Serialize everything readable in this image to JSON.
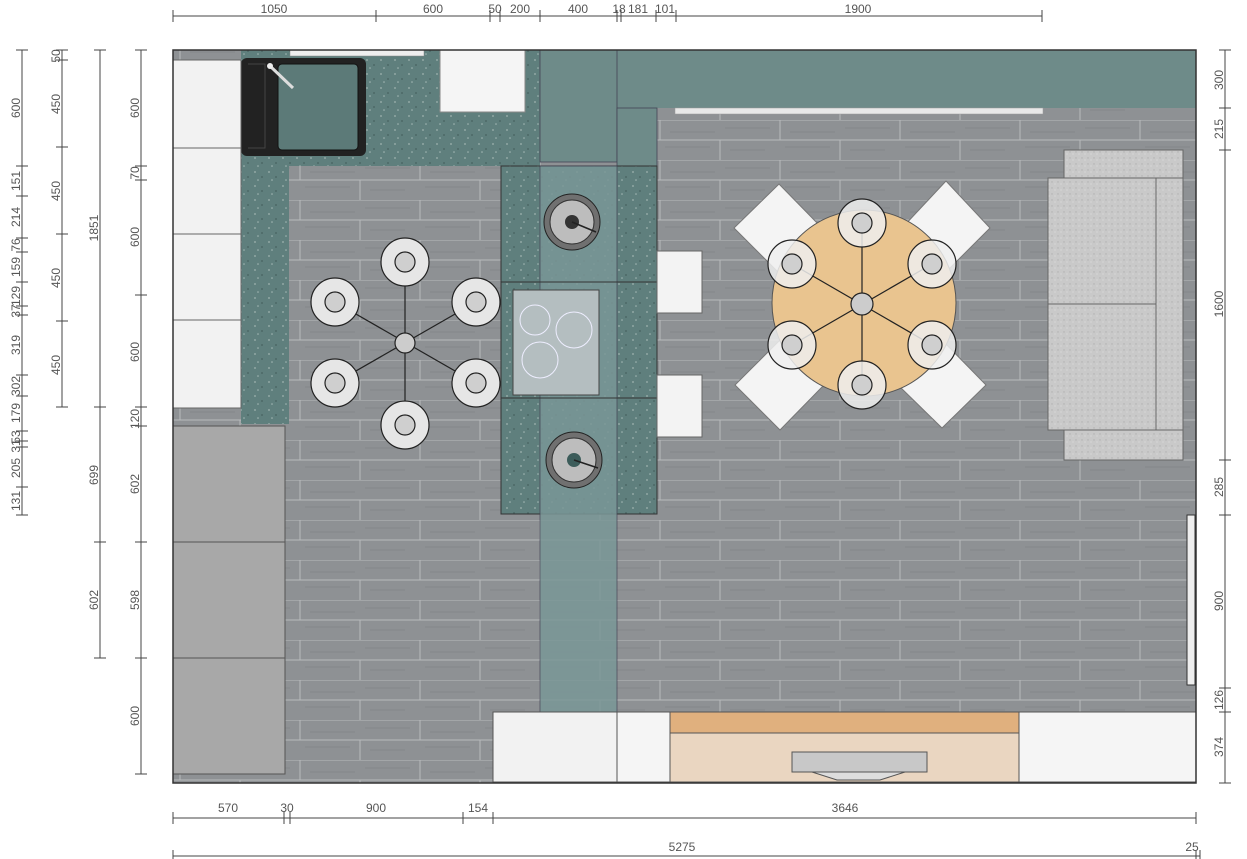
{
  "dimensions": {
    "top": [
      "1050",
      "600",
      "50",
      "200",
      "400",
      "18",
      "181",
      "101",
      "1900"
    ],
    "bottom": [
      "570",
      "30",
      "900",
      "154",
      "3646"
    ],
    "overall_bottom": [
      "5275",
      "25"
    ],
    "left_col1": [
      "600",
      "151",
      "214",
      "76",
      "159",
      "129",
      "37",
      "319",
      "302",
      "179",
      "53",
      "31",
      "205",
      "131"
    ],
    "left_col2": [
      "50",
      "450",
      "450",
      "450",
      "450"
    ],
    "left_col3": [
      "1851",
      "699",
      "602"
    ],
    "left_col4": [
      "600",
      "70",
      "600",
      "600",
      "120",
      "602",
      "598",
      "600"
    ],
    "right": [
      "300",
      "215",
      "1600",
      "285",
      "900",
      "126",
      "374"
    ]
  },
  "colors": {
    "floor": "#8a8d90",
    "wall_green": "#6f8c8a",
    "counter": "#587a7a",
    "cabinet_white": "#f0f0f0",
    "cabinet_grey": "#a9a9a9",
    "table_wood": "#e8c28f",
    "sofa": "#c8c8c8",
    "tv_wood": "#e7d3bf"
  },
  "icons": [
    "pendant-light-icon",
    "chandelier-icon",
    "cooktop-icon",
    "sink-icon",
    "faucet-icon"
  ]
}
